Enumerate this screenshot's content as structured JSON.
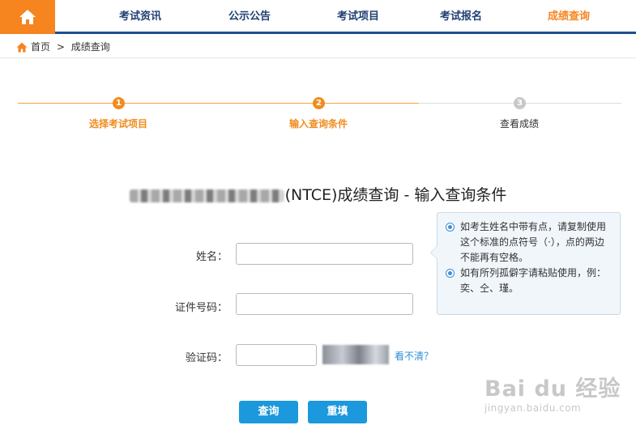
{
  "nav": {
    "items": [
      "考试资讯",
      "公示公告",
      "考试项目",
      "考试报名",
      "成绩查询"
    ],
    "active_index": 4
  },
  "breadcrumb": {
    "home": "首页",
    "separator": ">",
    "current": "成绩查询"
  },
  "steps": [
    {
      "number": "1",
      "label": "选择考试项目",
      "status": "done"
    },
    {
      "number": "2",
      "label": "输入查询条件",
      "status": "done"
    },
    {
      "number": "3",
      "label": "查看成绩",
      "status": "todo"
    }
  ],
  "title": {
    "visible_text": "(NTCE)成绩查询 - 输入查询条件"
  },
  "form": {
    "name_label": "姓名：",
    "name_value": "",
    "id_label": "证件号码：",
    "id_value": "",
    "captcha_label": "验证码：",
    "captcha_value": "",
    "refresh_link": "看不清？"
  },
  "tips": [
    "如考生姓名中带有点，请复制使用这个标准的点符号（·），点的两边不能再有空格。",
    "如有所列孤僻字请粘贴使用，例：奕、仝、瑾。"
  ],
  "buttons": {
    "query": "查询",
    "reset": "重填"
  },
  "watermark": {
    "main": "Bai du 经验",
    "sub": "jingyan.baidu.com"
  },
  "colors": {
    "accent": "#f6841f",
    "nav_text": "#1f3f73",
    "button": "#1c98dc",
    "link": "#2b8fd6"
  }
}
